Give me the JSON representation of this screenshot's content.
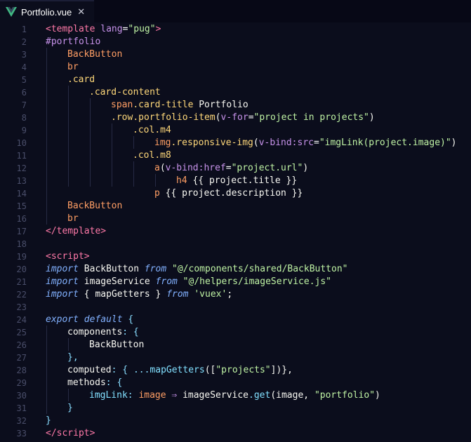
{
  "tab": {
    "filename": "Portfolio.vue",
    "close_glyph": "✕"
  },
  "colors": {
    "tag": "#ff79a8",
    "attribute": "#c792ea",
    "string": "#bff3a4",
    "pug_element": "#ff9e64",
    "pug_class": "#ffd87a",
    "keyword": "#82b1ff",
    "punctuation": "#89ddff",
    "text": "#f8f8f2",
    "line_number": "#4a4e6a",
    "background": "#0b0d1c"
  },
  "lines": [
    {
      "n": "1",
      "tokens": [
        [
          "<",
          "t-tag"
        ],
        [
          "template",
          "t-tag"
        ],
        [
          " lang",
          "t-attr"
        ],
        [
          "=",
          "t-op"
        ],
        [
          "\"pug\"",
          "t-str"
        ],
        [
          ">",
          "t-tag"
        ]
      ]
    },
    {
      "n": "2",
      "tokens": [
        [
          "#portfolio",
          "t-attr"
        ]
      ]
    },
    {
      "n": "3",
      "tokens": [
        [
          "BackButton",
          "t-pug"
        ]
      ]
    },
    {
      "n": "4",
      "tokens": [
        [
          "br",
          "t-pug"
        ]
      ]
    },
    {
      "n": "5",
      "tokens": [
        [
          ".card",
          "t-cls"
        ]
      ]
    },
    {
      "n": "6",
      "tokens": [
        [
          ".card-content",
          "t-cls"
        ]
      ]
    },
    {
      "n": "7",
      "tokens": [
        [
          "span",
          "t-pug"
        ],
        [
          ".card-title",
          "t-cls"
        ],
        [
          " Portfolio",
          "t-id"
        ]
      ]
    },
    {
      "n": "8",
      "tokens": [
        [
          ".row",
          "t-cls"
        ],
        [
          ".portfolio-item",
          "t-cls"
        ],
        [
          "(",
          "t-id"
        ],
        [
          "v-for",
          "t-attr"
        ],
        [
          "=",
          "t-op"
        ],
        [
          "\"project in projects\"",
          "t-str"
        ],
        [
          ")",
          "t-id"
        ]
      ]
    },
    {
      "n": "9",
      "tokens": [
        [
          ".col",
          "t-cls"
        ],
        [
          ".m4",
          "t-cls"
        ]
      ]
    },
    {
      "n": "10",
      "tokens": [
        [
          "img",
          "t-pug"
        ],
        [
          ".responsive-img",
          "t-cls"
        ],
        [
          "(",
          "t-id"
        ],
        [
          "v-bind:src",
          "t-attr"
        ],
        [
          "=",
          "t-op"
        ],
        [
          "\"imgLink(project.image)\"",
          "t-str"
        ],
        [
          ")",
          "t-id"
        ]
      ]
    },
    {
      "n": "11",
      "tokens": [
        [
          ".col",
          "t-cls"
        ],
        [
          ".m8",
          "t-cls"
        ]
      ]
    },
    {
      "n": "12",
      "tokens": [
        [
          "a",
          "t-pug"
        ],
        [
          "(",
          "t-id"
        ],
        [
          "v-bind:href",
          "t-attr"
        ],
        [
          "=",
          "t-op"
        ],
        [
          "\"project.url\"",
          "t-str"
        ],
        [
          ")",
          "t-id"
        ]
      ]
    },
    {
      "n": "13",
      "tokens": [
        [
          "h4",
          "t-pug"
        ],
        [
          " {{ project.title }}",
          "t-id"
        ]
      ]
    },
    {
      "n": "14",
      "tokens": [
        [
          "p",
          "t-pug"
        ],
        [
          " {{ project.description }}",
          "t-id"
        ]
      ]
    },
    {
      "n": "15",
      "tokens": [
        [
          "BackButton",
          "t-pug"
        ]
      ]
    },
    {
      "n": "16",
      "tokens": [
        [
          "br",
          "t-pug"
        ]
      ]
    },
    {
      "n": "17",
      "tokens": [
        [
          "</",
          "t-tag"
        ],
        [
          "template",
          "t-tag"
        ],
        [
          ">",
          "t-tag"
        ]
      ]
    },
    {
      "n": "18",
      "tokens": []
    },
    {
      "n": "19",
      "tokens": [
        [
          "<",
          "t-tag"
        ],
        [
          "script",
          "t-tag"
        ],
        [
          ">",
          "t-tag"
        ]
      ]
    },
    {
      "n": "20",
      "tokens": [
        [
          "import",
          "t-kw"
        ],
        [
          " BackButton ",
          "t-id"
        ],
        [
          "from",
          "t-kw"
        ],
        [
          " \"@/components/shared/BackButton\"",
          "t-str"
        ]
      ]
    },
    {
      "n": "21",
      "tokens": [
        [
          "import",
          "t-kw"
        ],
        [
          " imageService ",
          "t-id"
        ],
        [
          "from",
          "t-kw"
        ],
        [
          " \"@/helpers/imageService.js\"",
          "t-str"
        ]
      ]
    },
    {
      "n": "22",
      "tokens": [
        [
          "import",
          "t-kw"
        ],
        [
          " { mapGetters } ",
          "t-id"
        ],
        [
          "from",
          "t-kw"
        ],
        [
          " 'vuex'",
          "t-str"
        ],
        [
          ";",
          "t-id"
        ]
      ]
    },
    {
      "n": "23",
      "tokens": []
    },
    {
      "n": "24",
      "tokens": [
        [
          "export",
          "t-kw"
        ],
        [
          " ",
          "t-id"
        ],
        [
          "default",
          "t-kw"
        ],
        [
          " {",
          "t-punc"
        ]
      ]
    },
    {
      "n": "25",
      "tokens": [
        [
          "components",
          "t-prop"
        ],
        [
          ": {",
          "t-punc"
        ]
      ]
    },
    {
      "n": "26",
      "tokens": [
        [
          "BackButton",
          "t-id"
        ]
      ]
    },
    {
      "n": "27",
      "tokens": [
        [
          "},",
          "t-punc"
        ]
      ]
    },
    {
      "n": "28",
      "tokens": [
        [
          "computed",
          "t-prop"
        ],
        [
          ": { ",
          "t-punc"
        ],
        [
          "...",
          "t-punc"
        ],
        [
          "mapGetters",
          "t-fn"
        ],
        [
          "([",
          "t-id"
        ],
        [
          "\"projects\"",
          "t-str"
        ],
        [
          "])},",
          "t-id"
        ]
      ]
    },
    {
      "n": "29",
      "tokens": [
        [
          "methods",
          "t-prop"
        ],
        [
          ": {",
          "t-punc"
        ]
      ]
    },
    {
      "n": "30",
      "tokens": [
        [
          "imgLink",
          "t-fn"
        ],
        [
          ": ",
          "t-punc"
        ],
        [
          "image",
          "t-pug"
        ],
        [
          " ⇒ ",
          "t-attr"
        ],
        [
          "imageService",
          "t-id"
        ],
        [
          ".",
          "t-punc"
        ],
        [
          "get",
          "t-fn"
        ],
        [
          "(image, ",
          "t-id"
        ],
        [
          "\"portfolio\"",
          "t-str"
        ],
        [
          ")",
          "t-id"
        ]
      ]
    },
    {
      "n": "31",
      "tokens": [
        [
          "}",
          "t-punc"
        ]
      ]
    },
    {
      "n": "32",
      "tokens": [
        [
          "}",
          "t-punc"
        ]
      ]
    },
    {
      "n": "33",
      "tokens": [
        [
          "</",
          "t-tag"
        ],
        [
          "script",
          "t-tag"
        ],
        [
          ">",
          "t-tag"
        ]
      ]
    }
  ]
}
